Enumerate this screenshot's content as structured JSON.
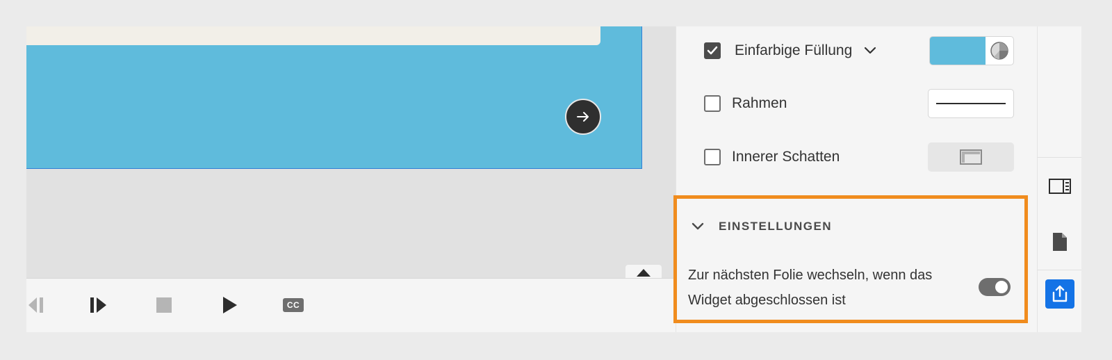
{
  "panel": {
    "fill": {
      "label": "Einfarbige Füllung",
      "checked": true,
      "color": "#5fbbdc"
    },
    "border": {
      "label": "Rahmen",
      "checked": false
    },
    "inner_shadow": {
      "label": "Innerer Schatten",
      "checked": false
    },
    "settings": {
      "title": "EINSTELLUNGEN",
      "option_text": "Zur nächsten Folie wechseln, wenn das Widget abgeschlossen ist",
      "toggle_on": true
    }
  },
  "playbar": {
    "buttons": [
      "rewind-icon",
      "step-forward-icon",
      "stop-icon",
      "play-icon",
      "closed-captions-icon"
    ],
    "cc_label": "CC"
  },
  "rail": {
    "icons": [
      "properties-panel-icon",
      "document-icon",
      "share-icon"
    ]
  },
  "colors": {
    "accent_highlight": "#f08c1e",
    "primary_blue": "#1473e6",
    "slide_blue": "#5fbbdc"
  }
}
